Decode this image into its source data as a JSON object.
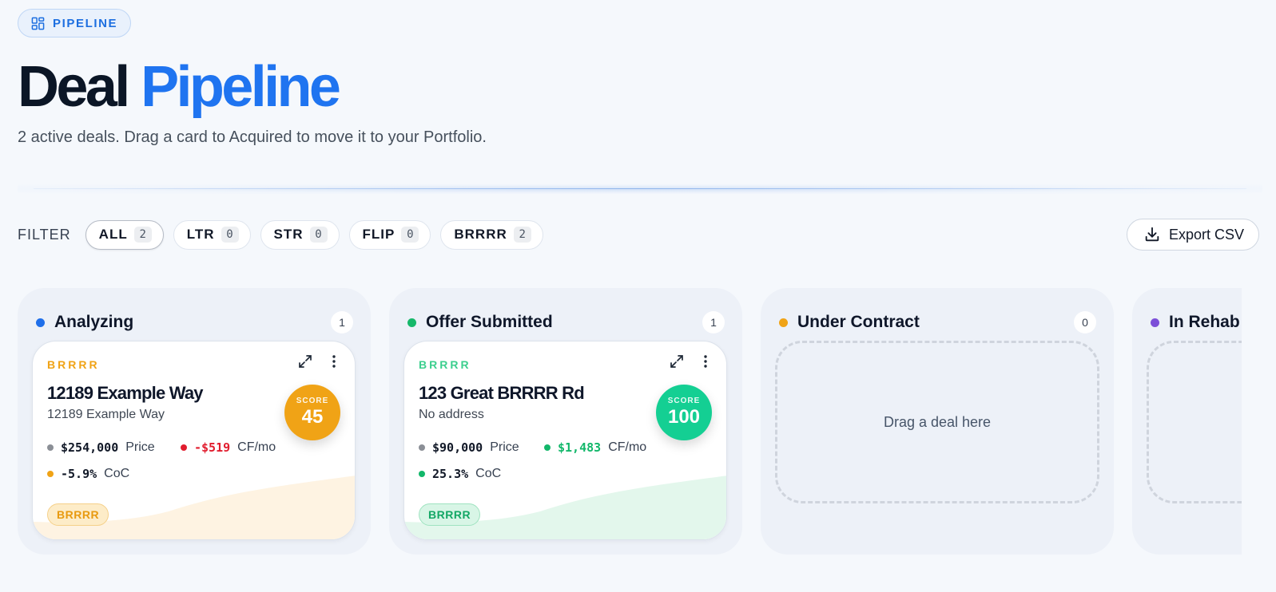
{
  "eyebrow": {
    "label": "PIPELINE",
    "icon": "dashboard-grid-icon"
  },
  "header": {
    "title_dark": "Deal",
    "title_accent": "Pipeline",
    "subtitle": "2 active deals. Drag a card to Acquired to move it to your Portfolio."
  },
  "filter": {
    "label": "FILTER",
    "chips": [
      {
        "label": "ALL",
        "count": "2",
        "active": true
      },
      {
        "label": "LTR",
        "count": "0",
        "active": false
      },
      {
        "label": "STR",
        "count": "0",
        "active": false
      },
      {
        "label": "FLIP",
        "count": "0",
        "active": false
      },
      {
        "label": "BRRRR",
        "count": "2",
        "active": false
      }
    ],
    "export_label": "Export CSV",
    "export_icon": "download-icon"
  },
  "columns": [
    {
      "title": "Analyzing",
      "count": "1",
      "color": "#1f6fea",
      "card": {
        "type": "BRRRR",
        "title": "12189 Example Way",
        "subtitle": "12189 Example Way",
        "score_label": "SCORE",
        "score": "45",
        "accent": "#f0a316",
        "price": "$254,000",
        "price_label": "Price",
        "cashflow": "-$519",
        "cashflow_label": "CF/mo",
        "cashflow_color": "#e11d2e",
        "coc": "-5.9%",
        "coc_label": "CoC",
        "tag": "BRRRR"
      }
    },
    {
      "title": "Offer Submitted",
      "count": "1",
      "color": "#16b86a",
      "card": {
        "type": "BRRRR",
        "title": "123 Great BRRRR Rd",
        "subtitle": "No address",
        "score_label": "SCORE",
        "score": "100",
        "accent": "#14cf93",
        "price": "$90,000",
        "price_label": "Price",
        "cashflow": "$1,483",
        "cashflow_label": "CF/mo",
        "cashflow_color": "#12b76a",
        "coc": "25.3%",
        "coc_label": "CoC",
        "tag": "BRRRR"
      }
    },
    {
      "title": "Under Contract",
      "count": "0",
      "color": "#f0a316",
      "dropzone": "Drag a deal here"
    },
    {
      "title": "In Rehab",
      "color": "#7c4fd8"
    }
  ]
}
